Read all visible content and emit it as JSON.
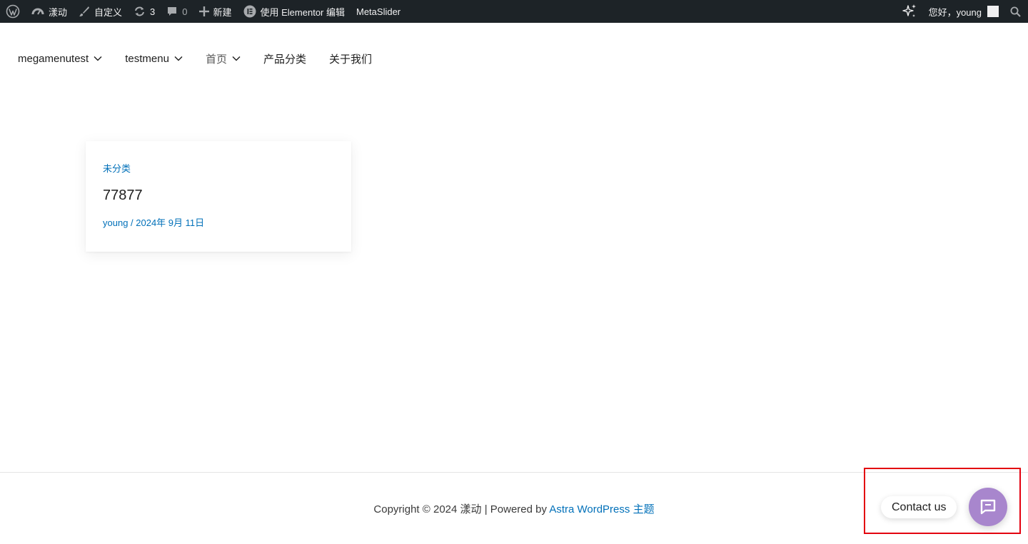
{
  "admin_bar": {
    "site_name": "漾动",
    "customize_label": "自定义",
    "updates_count": "3",
    "comments_count": "0",
    "new_label": "新建",
    "elementor_label": "使用 Elementor 编辑",
    "metaslider_label": "MetaSlider",
    "greeting": "您好，young",
    "icons": [
      "wordpress-logo-icon",
      "dashboard-icon",
      "brush-icon",
      "refresh-icon",
      "comment-icon",
      "plus-icon",
      "elementor-icon",
      "sparkle-icon",
      "search-icon"
    ]
  },
  "nav": {
    "items": [
      {
        "label": "megamenutest",
        "has_dropdown": true
      },
      {
        "label": "testmenu",
        "has_dropdown": true
      },
      {
        "label": "首页",
        "has_dropdown": true,
        "active": true
      },
      {
        "label": "产品分类",
        "has_dropdown": false
      },
      {
        "label": "关于我们",
        "has_dropdown": false
      }
    ]
  },
  "post": {
    "category": "未分类",
    "title": "77877",
    "author": "young",
    "separator": " / ",
    "date": "2024年 9月 11日"
  },
  "footer": {
    "copyright": "Copyright © 2024 漾动 | Powered by ",
    "theme_link": "Astra WordPress 主题"
  },
  "contact": {
    "label": "Contact us",
    "button_color": "#a886cd",
    "highlight_color": "#e3000f"
  },
  "colors": {
    "admin_bar_bg": "#1d2327",
    "link": "#0170b9",
    "text": "#1e1e1e"
  }
}
